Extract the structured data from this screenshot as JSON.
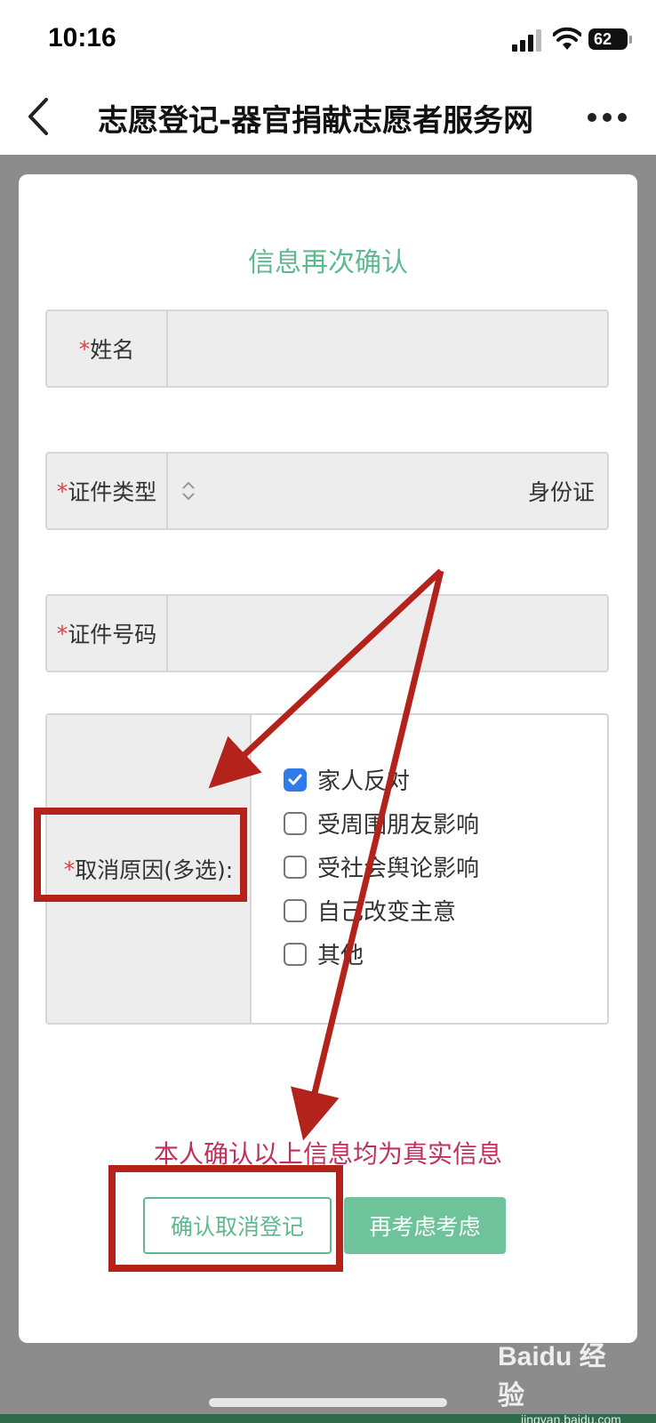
{
  "status_bar": {
    "time": "10:16",
    "battery": "62"
  },
  "nav": {
    "title": "志愿登记-器官捐献志愿者服务网"
  },
  "form": {
    "title": "信息再次确认",
    "required_mark": "*",
    "name": {
      "label": "姓名",
      "value": ""
    },
    "id_type": {
      "label": "证件类型",
      "value": "身份证"
    },
    "id_number": {
      "label": "证件号码",
      "value": ""
    },
    "reason": {
      "label": "取消原因(多选):",
      "options": [
        {
          "label": "家人反对",
          "checked": true
        },
        {
          "label": "受周围朋友影响",
          "checked": false
        },
        {
          "label": "受社会舆论影响",
          "checked": false
        },
        {
          "label": "自己改变主意",
          "checked": false
        },
        {
          "label": "其他",
          "checked": false
        }
      ]
    },
    "confirm_statement": "本人确认以上信息均为真实信息",
    "confirm_button": "确认取消登记",
    "reconsider_button": "再考虑考虑"
  },
  "watermark": {
    "logo": "Baidu 经验",
    "site": "jingyan.baidu.com"
  },
  "colors": {
    "accent_green": "#5fb98e",
    "button_green": "#6fc39a",
    "statement_red": "#c0305a",
    "annotation_red": "#b3231c",
    "checkbox_blue": "#2f7bea"
  }
}
